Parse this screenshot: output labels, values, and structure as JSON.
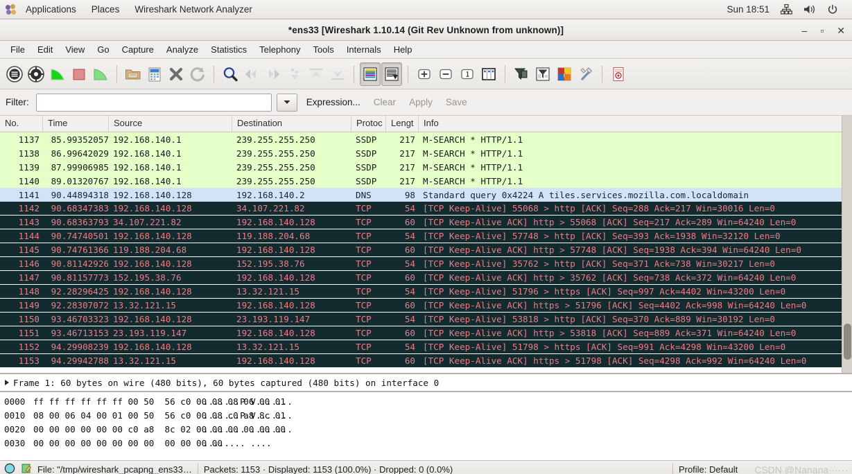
{
  "desktop_panel": {
    "logo_icon": "gnome-foot-icon",
    "menus": [
      "Applications",
      "Places"
    ],
    "app_name": "Wireshark Network Analyzer",
    "clock": "Sun 18:51",
    "tray": [
      "network-icon",
      "volume-icon",
      "power-icon"
    ]
  },
  "window": {
    "title": "*ens33  [Wireshark 1.10.14  (Git Rev Unknown from unknown)]",
    "minimize": "–",
    "maximize": "▫",
    "close": "✕"
  },
  "menubar": {
    "items": [
      "File",
      "Edit",
      "View",
      "Go",
      "Capture",
      "Analyze",
      "Statistics",
      "Telephony",
      "Tools",
      "Internals",
      "Help"
    ]
  },
  "toolbar": {
    "buttons": [
      {
        "name": "interfaces-icon",
        "group": 0
      },
      {
        "name": "capture-options-icon",
        "group": 0
      },
      {
        "name": "start-capture-icon",
        "group": 0
      },
      {
        "name": "stop-capture-icon",
        "group": 0
      },
      {
        "name": "restart-capture-icon",
        "group": 0
      },
      {
        "name": "open-file-icon",
        "group": 1
      },
      {
        "name": "save-file-icon",
        "group": 1
      },
      {
        "name": "close-file-icon",
        "group": 1
      },
      {
        "name": "reload-file-icon",
        "group": 1
      },
      {
        "name": "find-packet-icon",
        "group": 2
      },
      {
        "name": "go-back-icon",
        "group": 2
      },
      {
        "name": "go-forward-icon",
        "group": 2
      },
      {
        "name": "go-to-packet-icon",
        "group": 2
      },
      {
        "name": "go-first-packet-icon",
        "group": 2
      },
      {
        "name": "go-last-packet-icon",
        "group": 2
      },
      {
        "name": "colorize-packet-list-icon",
        "group": 3
      },
      {
        "name": "auto-scroll-live-capture-icon",
        "group": 3
      },
      {
        "name": "zoom-in-icon",
        "group": 4
      },
      {
        "name": "zoom-out-icon",
        "group": 4
      },
      {
        "name": "zoom-reset-icon",
        "group": 4
      },
      {
        "name": "resize-columns-icon",
        "group": 4
      },
      {
        "name": "capture-filters-icon",
        "group": 5
      },
      {
        "name": "display-filters-icon",
        "group": 5
      },
      {
        "name": "coloring-rules-icon",
        "group": 5
      },
      {
        "name": "preferences-icon",
        "group": 5
      },
      {
        "name": "help-contents-icon",
        "group": 6
      }
    ]
  },
  "filter_bar": {
    "label": "Filter:",
    "value": "",
    "placeholder": "",
    "dropdown_icon": "chevron-down-icon",
    "expression_label": "Expression...",
    "clear_label": "Clear",
    "apply_label": "Apply",
    "save_label": "Save"
  },
  "packet_list": {
    "columns": [
      "No.",
      "Time",
      "Source",
      "Destination",
      "Protocol",
      "Length",
      "Info"
    ],
    "column_headers_displayed": [
      "No.",
      "Time",
      "Source",
      "Destination",
      "Protoc",
      "Lengt",
      "Info"
    ],
    "rows": [
      {
        "no": "1137",
        "time": "85.99352057",
        "src": "192.168.140.1",
        "dst": "239.255.255.250",
        "proto": "SSDP",
        "len": "217",
        "info": "M-SEARCH * HTTP/1.1",
        "style": "green"
      },
      {
        "no": "1138",
        "time": "86.99642029",
        "src": "192.168.140.1",
        "dst": "239.255.255.250",
        "proto": "SSDP",
        "len": "217",
        "info": "M-SEARCH * HTTP/1.1",
        "style": "green"
      },
      {
        "no": "1139",
        "time": "87.99906985",
        "src": "192.168.140.1",
        "dst": "239.255.255.250",
        "proto": "SSDP",
        "len": "217",
        "info": "M-SEARCH * HTTP/1.1",
        "style": "green"
      },
      {
        "no": "1140",
        "time": "89.01320767",
        "src": "192.168.140.1",
        "dst": "239.255.255.250",
        "proto": "SSDP",
        "len": "217",
        "info": "M-SEARCH * HTTP/1.1",
        "style": "green"
      },
      {
        "no": "1141",
        "time": "90.44894318",
        "src": "192.168.140.128",
        "dst": "192.168.140.2",
        "proto": "DNS",
        "len": "98",
        "info": "Standard query 0x4224  A tiles.services.mozilla.com.localdomain",
        "style": "blue"
      },
      {
        "no": "1142",
        "time": "90.68347383",
        "src": "192.168.140.128",
        "dst": "34.107.221.82",
        "proto": "TCP",
        "len": "54",
        "info": "[TCP Keep-Alive] 55068 > http [ACK] Seq=288 Ack=217 Win=30016 Len=0",
        "style": "dark"
      },
      {
        "no": "1143",
        "time": "90.68363793",
        "src": "34.107.221.82",
        "dst": "192.168.140.128",
        "proto": "TCP",
        "len": "60",
        "info": "[TCP Keep-Alive ACK] http > 55068 [ACK] Seq=217 Ack=289 Win=64240 Len=0",
        "style": "dark"
      },
      {
        "no": "1144",
        "time": "90.74740501",
        "src": "192.168.140.128",
        "dst": "119.188.204.68",
        "proto": "TCP",
        "len": "54",
        "info": "[TCP Keep-Alive] 57748 > http [ACK] Seq=393 Ack=1938 Win=32120 Len=0",
        "style": "dark"
      },
      {
        "no": "1145",
        "time": "90.74761366",
        "src": "119.188.204.68",
        "dst": "192.168.140.128",
        "proto": "TCP",
        "len": "60",
        "info": "[TCP Keep-Alive ACK] http > 57748 [ACK] Seq=1938 Ack=394 Win=64240 Len=0",
        "style": "dark"
      },
      {
        "no": "1146",
        "time": "90.81142926",
        "src": "192.168.140.128",
        "dst": "152.195.38.76",
        "proto": "TCP",
        "len": "54",
        "info": "[TCP Keep-Alive] 35762 > http [ACK] Seq=371 Ack=738 Win=30217 Len=0",
        "style": "dark"
      },
      {
        "no": "1147",
        "time": "90.81157773",
        "src": "152.195.38.76",
        "dst": "192.168.140.128",
        "proto": "TCP",
        "len": "60",
        "info": "[TCP Keep-Alive ACK] http > 35762 [ACK] Seq=738 Ack=372 Win=64240 Len=0",
        "style": "dark"
      },
      {
        "no": "1148",
        "time": "92.28296425",
        "src": "192.168.140.128",
        "dst": "13.32.121.15",
        "proto": "TCP",
        "len": "54",
        "info": "[TCP Keep-Alive] 51796 > https [ACK] Seq=997 Ack=4402 Win=43200 Len=0",
        "style": "dark"
      },
      {
        "no": "1149",
        "time": "92.28307072",
        "src": "13.32.121.15",
        "dst": "192.168.140.128",
        "proto": "TCP",
        "len": "60",
        "info": "[TCP Keep-Alive ACK] https > 51796 [ACK] Seq=4402 Ack=998 Win=64240 Len=0",
        "style": "dark"
      },
      {
        "no": "1150",
        "time": "93.46703323",
        "src": "192.168.140.128",
        "dst": "23.193.119.147",
        "proto": "TCP",
        "len": "54",
        "info": "[TCP Keep-Alive] 53818 > http [ACK] Seq=370 Ack=889 Win=30192 Len=0",
        "style": "dark"
      },
      {
        "no": "1151",
        "time": "93.46713153",
        "src": "23.193.119.147",
        "dst": "192.168.140.128",
        "proto": "TCP",
        "len": "60",
        "info": "[TCP Keep-Alive ACK] http > 53818 [ACK] Seq=889 Ack=371 Win=64240 Len=0",
        "style": "dark"
      },
      {
        "no": "1152",
        "time": "94.29908239",
        "src": "192.168.140.128",
        "dst": "13.32.121.15",
        "proto": "TCP",
        "len": "54",
        "info": "[TCP Keep-Alive] 51798 > https [ACK] Seq=991 Ack=4298 Win=43200 Len=0",
        "style": "dark"
      },
      {
        "no": "1153",
        "time": "94.29942788",
        "src": "13.32.121.15",
        "dst": "192.168.140.128",
        "proto": "TCP",
        "len": "60",
        "info": "[TCP Keep-Alive ACK] https > 51798 [ACK] Seq=4298 Ack=992 Win=64240 Len=0",
        "style": "dark"
      }
    ]
  },
  "detail_pane": {
    "frame_summary": "Frame 1: 60 bytes on wire (480 bits), 60 bytes captured (480 bits) on interface 0",
    "expander_icon": "disclosure-triangle-icon"
  },
  "hex_pane": {
    "lines": [
      {
        "offset": "0000",
        "bytes": "ff ff ff ff ff ff 00 50  56 c0 00 08 08 06 00 01",
        "ascii": ".......P V......."
      },
      {
        "offset": "0010",
        "bytes": "08 00 06 04 00 01 00 50  56 c0 00 08 c0 a8 8c 01",
        "ascii": ".......P V......."
      },
      {
        "offset": "0020",
        "bytes": "00 00 00 00 00 00 c0 a8  8c 02 00 00 00 00 00 00",
        "ascii": "........ ........"
      },
      {
        "offset": "0030",
        "bytes": "00 00 00 00 00 00 00 00  00 00 00 00",
        "ascii": "........ ...."
      }
    ]
  },
  "status_bar": {
    "expert_icon": "expert-info-icon",
    "annotation_icon": "capture-comment-icon",
    "file_text": "File: \"/tmp/wireshark_pcapng_ens33…",
    "counts_text": "Packets: 1153 · Displayed: 1153 (100.0%)  · Dropped: 0 (0.0%)",
    "profile_text": "Profile: Default",
    "watermark": "CSDN @Nanana······"
  },
  "colors": {
    "row_green_bg": "#e4ffc7",
    "row_blue_bg": "#d3e3f7",
    "row_dark_bg": "#122b2e",
    "row_dark_fg": "#f07a86",
    "panel_bg": "#f0efed",
    "titlebar_bg": "#f6f5f3"
  }
}
